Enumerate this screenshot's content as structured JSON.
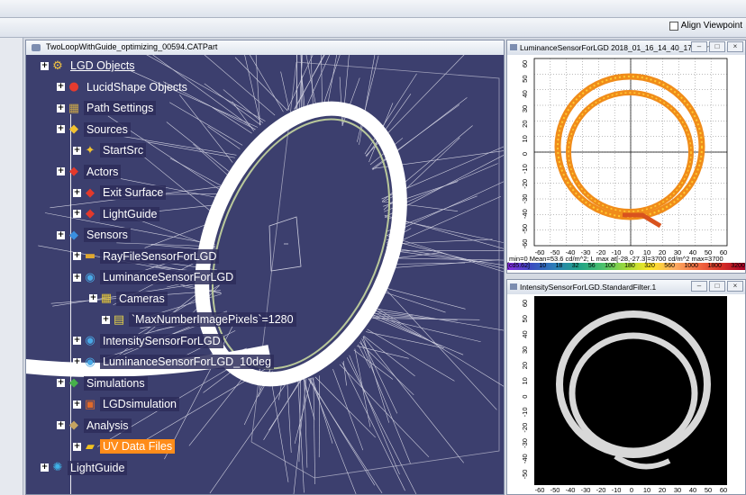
{
  "toolbar": {
    "align_viewpoint_label": "Align Viewpoint"
  },
  "viewport": {
    "title": "TwoLoopWithGuide_optimizing_00594.CATPart"
  },
  "tree": [
    {
      "label": "LGD Objects",
      "level": 0,
      "icon": "lgd-objects-icon",
      "glyph": "⚙",
      "color": "#f5c542",
      "style": "u plain"
    },
    {
      "label": "LucidShape Objects",
      "level": 1,
      "icon": "lucidshape-icon",
      "glyph": "●",
      "color": "#e63b2e",
      "style": "plain"
    },
    {
      "label": "Path Settings",
      "level": 2,
      "icon": "path-settings-icon",
      "glyph": "▦",
      "color": "#c9a54a",
      "style": ""
    },
    {
      "label": "Sources",
      "level": 2,
      "icon": "sources-icon",
      "glyph": "◆",
      "color": "#f2c230",
      "style": ""
    },
    {
      "label": "StartSrc",
      "level": 3,
      "icon": "source-icon",
      "glyph": "✦",
      "color": "#f2c230",
      "style": ""
    },
    {
      "label": "Actors",
      "level": 2,
      "icon": "actors-icon",
      "glyph": "◆",
      "color": "#e3392b",
      "style": ""
    },
    {
      "label": "Exit Surface",
      "level": 3,
      "icon": "actor-icon",
      "glyph": "◆",
      "color": "#e3392b",
      "style": ""
    },
    {
      "label": "LightGuide",
      "level": 3,
      "icon": "actor-icon",
      "glyph": "◆",
      "color": "#e3392b",
      "style": ""
    },
    {
      "label": "Sensors",
      "level": 2,
      "icon": "sensors-icon",
      "glyph": "◆",
      "color": "#3a8fe0",
      "style": ""
    },
    {
      "label": "RayFileSensorForLGD",
      "level": 3,
      "icon": "rayfile-sensor-icon",
      "glyph": "▬",
      "color": "#e0a830",
      "style": ""
    },
    {
      "label": "LuminanceSensorForLGD",
      "level": 3,
      "icon": "luminance-sensor-icon",
      "glyph": "◉",
      "color": "#49a8e6",
      "style": ""
    },
    {
      "label": "Cameras",
      "level": 4,
      "icon": "cameras-icon",
      "glyph": "▦",
      "color": "#e4c63a",
      "style": ""
    },
    {
      "label": "`MaxNumberImagePixels`=1280",
      "level": 5,
      "icon": "parameter-icon",
      "glyph": "▤",
      "color": "#e5d24a",
      "style": ""
    },
    {
      "label": "IntensitySensorForLGD",
      "level": 3,
      "icon": "intensity-sensor-icon",
      "glyph": "◉",
      "color": "#49a8e6",
      "style": ""
    },
    {
      "label": "LuminanceSensorForLGD_10deg",
      "level": 3,
      "icon": "luminance-sensor-icon",
      "glyph": "◉",
      "color": "#49a8e6",
      "style": ""
    },
    {
      "label": "Simulations",
      "level": 2,
      "icon": "simulations-icon",
      "glyph": "◆",
      "color": "#46b04a",
      "style": ""
    },
    {
      "label": "LGDsimulation",
      "level": 3,
      "icon": "simulation-icon",
      "glyph": "▣",
      "color": "#e06a2a",
      "style": ""
    },
    {
      "label": "Analysis",
      "level": 2,
      "icon": "analysis-icon",
      "glyph": "◆",
      "color": "#c6a460",
      "style": ""
    },
    {
      "label": "UV Data Files",
      "level": 3,
      "icon": "folder-icon",
      "glyph": "▰",
      "color": "#f3c21f",
      "style": "sel"
    },
    {
      "label": "LightGuide",
      "level": 0,
      "icon": "lightguide-icon",
      "glyph": "✺",
      "color": "#3fb3e8",
      "style": ""
    }
  ],
  "luminance_window": {
    "title": "LuminanceSensorForLGD 2018_01_16_14_40_17 (Part5)",
    "y_ticks": [
      "60",
      "50",
      "40",
      "30",
      "20",
      "10",
      "0",
      "-10",
      "-20",
      "-30",
      "-40",
      "-50",
      "-60"
    ],
    "x_ticks": [
      "-60",
      "-50",
      "-40",
      "-30",
      "-20",
      "-10",
      "0",
      "10",
      "20",
      "30",
      "40",
      "50",
      "60"
    ],
    "stats": "min=0      Mean=53.6 cd/m^2; L max at[-28,-27.3]=3700 cd/m^2     max=3700",
    "scale_labels": [
      "[cd5.62]",
      "10",
      "18",
      "32",
      "56",
      "100",
      "180",
      "320",
      "560",
      "1000",
      "1800",
      "3200"
    ]
  },
  "intensity_window": {
    "title": "IntensitySensorForLGD.StandardFilter.1",
    "y_ticks": [
      "60",
      "50",
      "40",
      "30",
      "20",
      "10",
      "0",
      "-10",
      "-20",
      "-30",
      "-40",
      "-50"
    ],
    "x_ticks": [
      "-60",
      "-50",
      "-40",
      "-30",
      "-20",
      "-10",
      "0",
      "10",
      "20",
      "30",
      "40",
      "50",
      "60"
    ]
  }
}
